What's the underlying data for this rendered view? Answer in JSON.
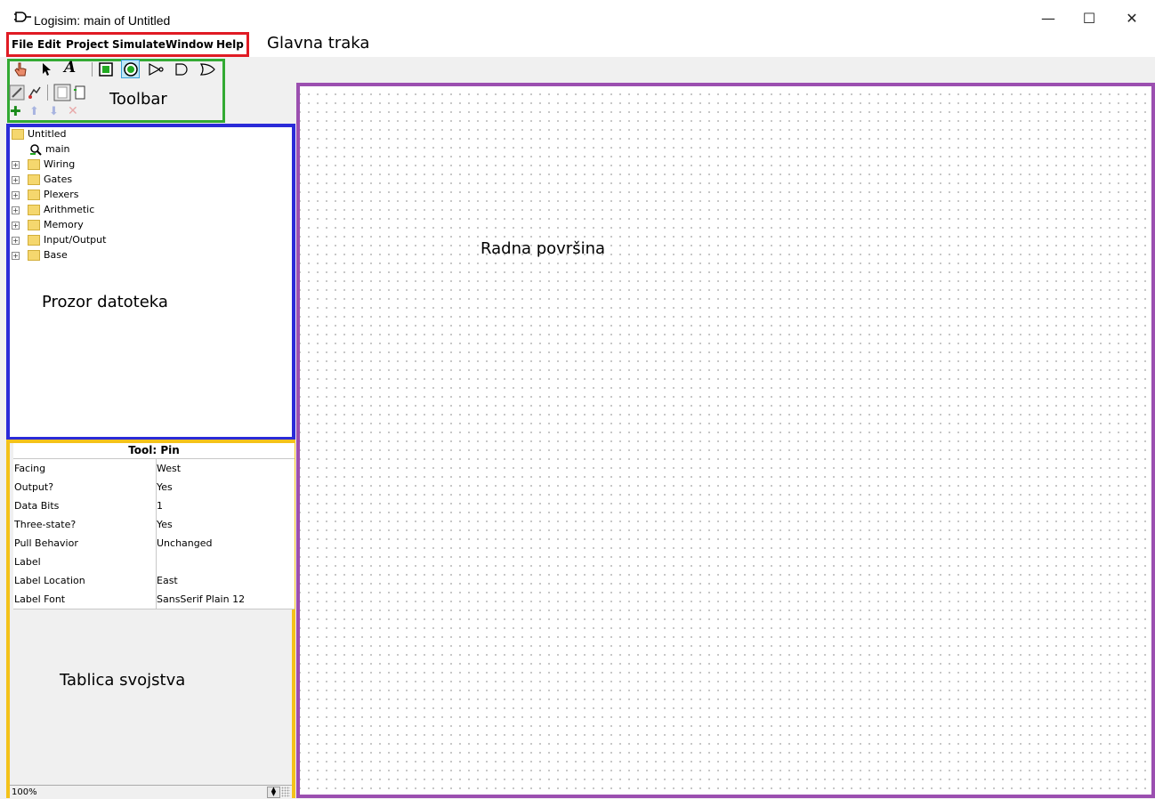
{
  "window": {
    "title": "Logisim: main of Untitled",
    "controls": {
      "minimize": "—",
      "maximize": "☐",
      "close": "✕"
    }
  },
  "menu": {
    "items": [
      "File",
      "Edit",
      "Project",
      "Simulate",
      "Window",
      "Help"
    ],
    "annotation": "Glavna traka"
  },
  "toolbar": {
    "annotation": "Toolbar",
    "tools": [
      "poke-tool-icon",
      "select-tool-icon",
      "text-tool-icon",
      "input-pin-icon",
      "output-pin-icon",
      "not-gate-icon",
      "and-gate-icon",
      "or-gate-icon"
    ],
    "secondary": [
      "wiring-edit-icon",
      "probe-icon",
      "appearance-icon",
      "layout-icon"
    ],
    "project_actions": [
      "add-circuit-icon",
      "move-up-icon",
      "move-down-icon",
      "remove-icon"
    ]
  },
  "explorer": {
    "annotation": "Prozor datoteka",
    "project": "Untitled",
    "circuit": "main",
    "libraries": [
      "Wiring",
      "Gates",
      "Plexers",
      "Arithmetic",
      "Memory",
      "Input/Output",
      "Base"
    ]
  },
  "attributes": {
    "annotation": "Tablica svojstva",
    "title": "Tool: Pin",
    "rows": [
      {
        "key": "Facing",
        "value": "West"
      },
      {
        "key": "Output?",
        "value": "Yes"
      },
      {
        "key": "Data Bits",
        "value": "1"
      },
      {
        "key": "Three-state?",
        "value": "Yes"
      },
      {
        "key": "Pull Behavior",
        "value": "Unchanged"
      },
      {
        "key": "Label",
        "value": ""
      },
      {
        "key": "Label Location",
        "value": "East"
      },
      {
        "key": "Label Font",
        "value": "SansSerif Plain 12"
      }
    ],
    "zoom": "100%"
  },
  "canvas": {
    "annotation": "Radna površina"
  },
  "colors": {
    "menu_box": "#e01b24",
    "toolbar_box": "#33aa33",
    "explorer_box": "#2b2bd8",
    "attributes_box": "#f4c21a",
    "canvas_box": "#9b4fb0"
  }
}
